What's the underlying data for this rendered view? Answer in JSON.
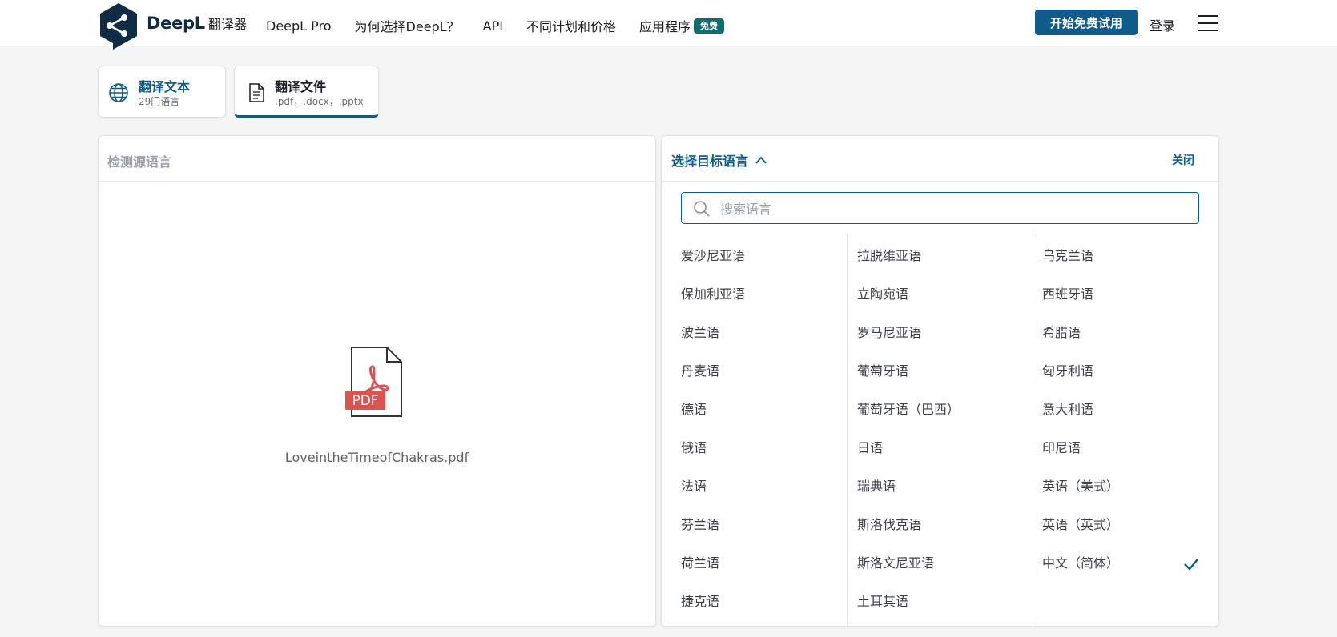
{
  "header": {
    "brand_name": "DeepL",
    "brand_sub": "翻译器",
    "nav": [
      "DeepL Pro",
      "为何选择DeepL？",
      "API",
      "不同计划和价格"
    ],
    "app_label": "应用程序",
    "app_badge": "免费",
    "trial_button": "开始免费试用",
    "login": "登录"
  },
  "tabs": {
    "text": {
      "title": "翻译文本",
      "sub": "29门语言"
    },
    "file": {
      "title": "翻译文件",
      "sub": ".pdf，.docx，.pptx"
    }
  },
  "left_panel": {
    "source_lang": "检测源语言",
    "file_name": "LoveintheTimeofChakras.pdf",
    "file_type": "PDF"
  },
  "right_panel": {
    "target_lang": "选择目标语言",
    "close": "关闭",
    "search_placeholder": "搜索语言",
    "columns": [
      [
        "爱沙尼亚语",
        "保加利亚语",
        "波兰语",
        "丹麦语",
        "德语",
        "俄语",
        "法语",
        "芬兰语",
        "荷兰语",
        "捷克语"
      ],
      [
        "拉脱维亚语",
        "立陶宛语",
        "罗马尼亚语",
        "葡萄牙语",
        "葡萄牙语（巴西）",
        "日语",
        "瑞典语",
        "斯洛伐克语",
        "斯洛文尼亚语",
        "土耳其语"
      ],
      [
        "乌克兰语",
        "西班牙语",
        "希腊语",
        "匈牙利语",
        "意大利语",
        "印尼语",
        "英语（美式）",
        "英语（英式）",
        "中文（简体）"
      ]
    ],
    "selected": "中文（简体）"
  },
  "colors": {
    "brand": "#0f2b46",
    "accent": "#0f5c8a",
    "badge": "#0d6e6e",
    "pdf_red": "#d9534f"
  },
  "icons": [
    "deepl-logo",
    "hamburger-menu-icon",
    "globe-icon",
    "document-icon",
    "pdf-icon",
    "search-icon",
    "chevron-up-icon",
    "check-icon"
  ]
}
